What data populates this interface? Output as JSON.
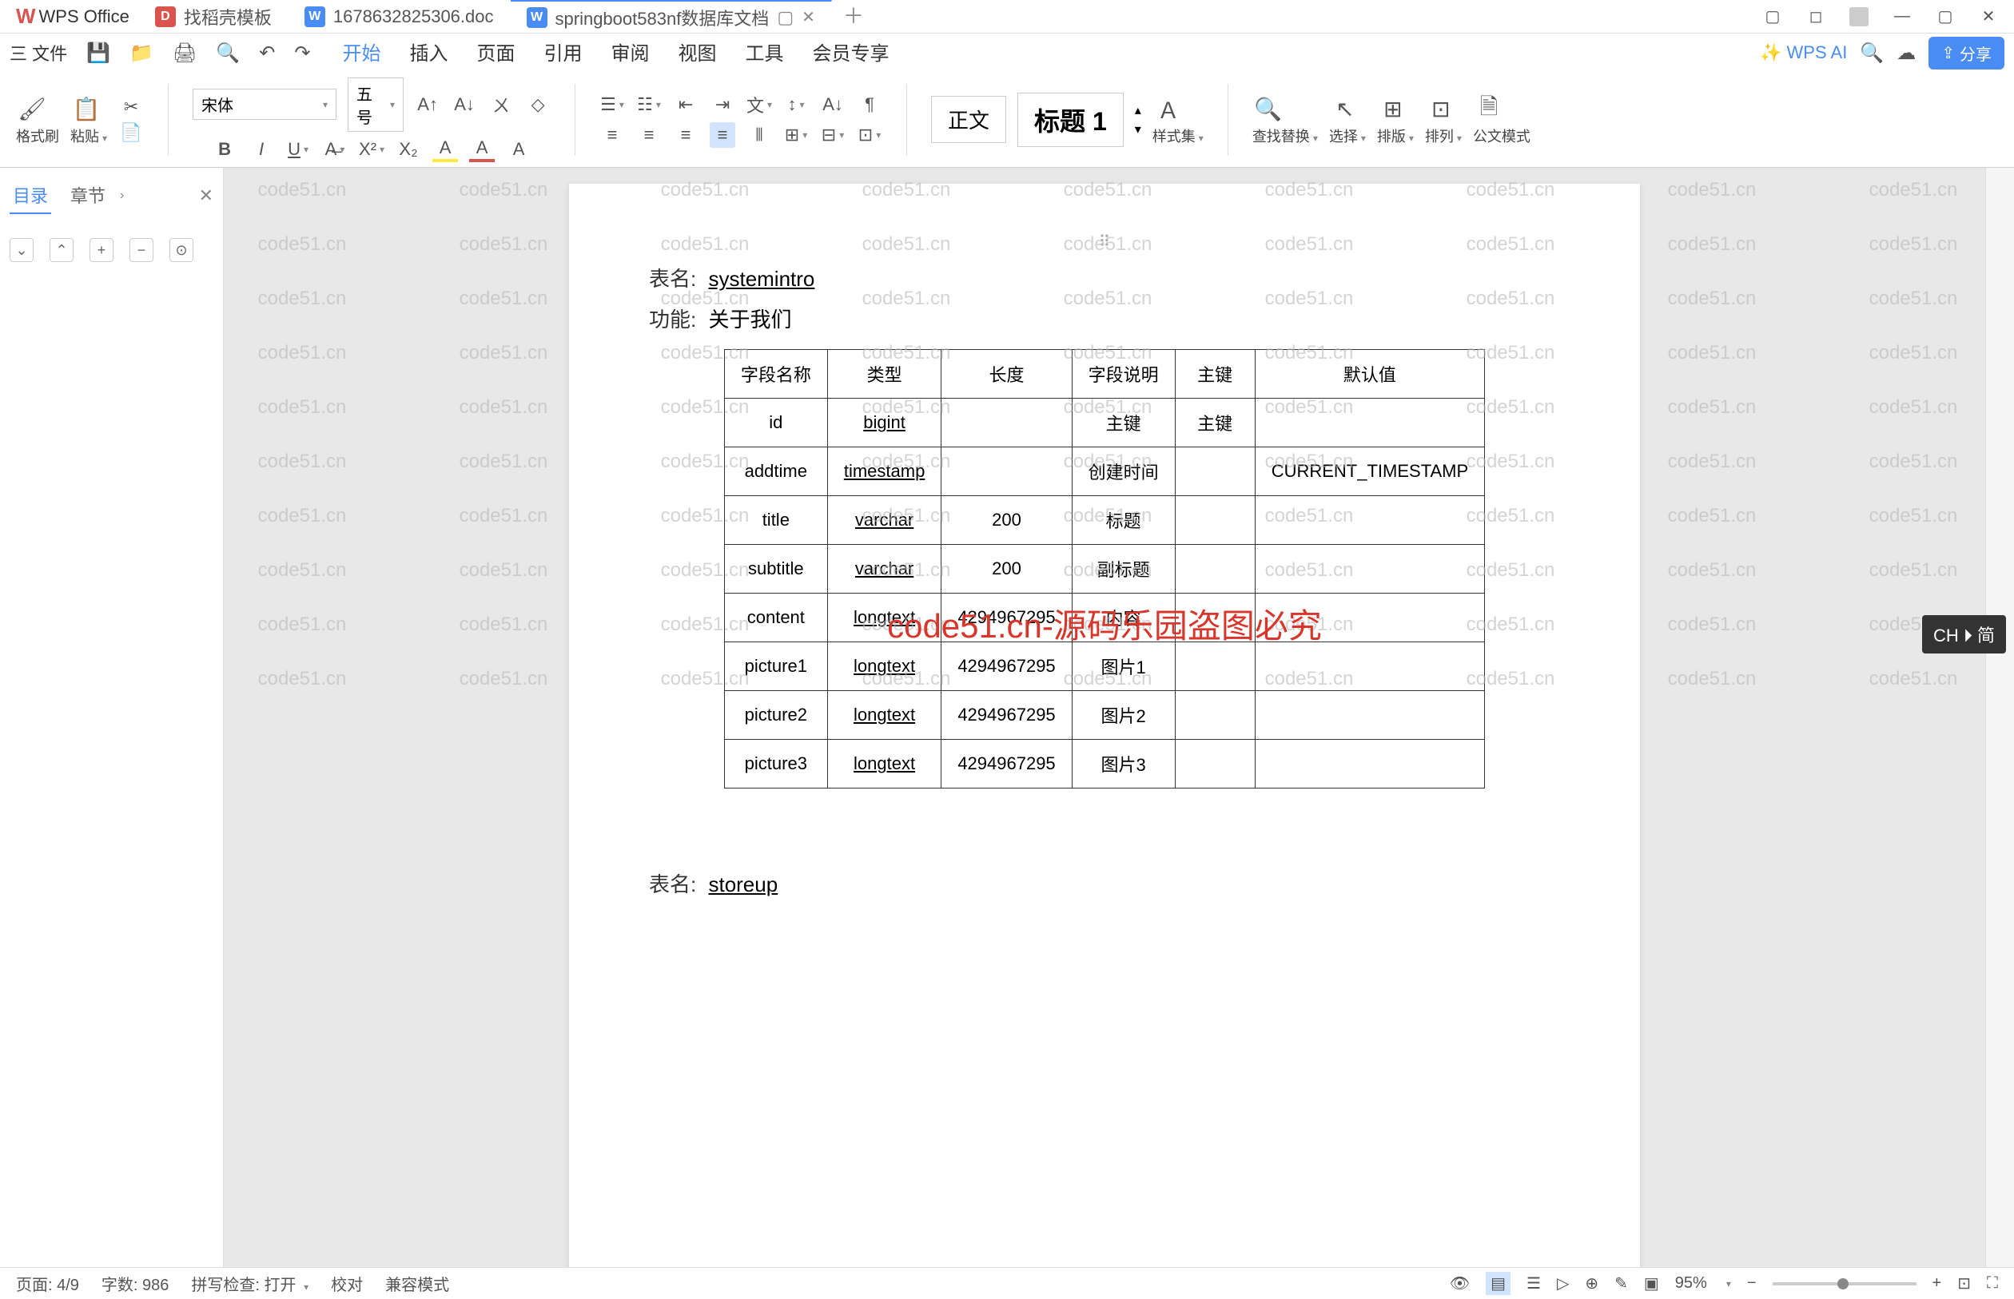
{
  "app": {
    "name": "WPS Office"
  },
  "tabs": [
    {
      "label": "找稻壳模板",
      "iconType": "red"
    },
    {
      "label": "1678632825306.doc",
      "iconType": "blue"
    },
    {
      "label": "springboot583nf数据库文档",
      "iconType": "blue",
      "active": true
    }
  ],
  "menubar": {
    "fileLabel": "三 文件",
    "items": [
      "开始",
      "插入",
      "页面",
      "引用",
      "审阅",
      "视图",
      "工具",
      "会员专享"
    ],
    "activeIndex": 0,
    "ai": "WPS AI",
    "share": "分享"
  },
  "ribbon": {
    "formatPainter": "格式刷",
    "paste": "粘贴",
    "fontName": "宋体",
    "fontSize": "五号",
    "styleNormal": "正文",
    "styleH1": "标题 1",
    "styleSet": "样式集",
    "findReplace": "查找替换",
    "select": "选择",
    "sort": "排版",
    "arrange": "排列",
    "formulaMode": "公文模式"
  },
  "sidebar": {
    "tabs": [
      "目录",
      "章节"
    ],
    "activeIndex": 0
  },
  "document": {
    "tableNameLabel": "表名:",
    "tableName1": "systemintro",
    "functionLabel": "功能:",
    "function1": "关于我们",
    "tableName2": "storeup",
    "headers": [
      "字段名称",
      "类型",
      "长度",
      "字段说明",
      "主键",
      "默认值"
    ],
    "rows": [
      {
        "name": "id",
        "type": "bigint",
        "len": "",
        "desc": "主键",
        "pk": "主键",
        "def": ""
      },
      {
        "name": "addtime",
        "type": "timestamp",
        "len": "",
        "desc": "创建时间",
        "pk": "",
        "def": "CURRENT_TIMESTAMP"
      },
      {
        "name": "title",
        "type": "varchar",
        "len": "200",
        "desc": "标题",
        "pk": "",
        "def": ""
      },
      {
        "name": "subtitle",
        "type": "varchar",
        "len": "200",
        "desc": "副标题",
        "pk": "",
        "def": ""
      },
      {
        "name": "content",
        "type": "longtext",
        "len": "4294967295",
        "desc": "内容",
        "pk": "",
        "def": ""
      },
      {
        "name": "picture1",
        "type": "longtext",
        "len": "4294967295",
        "desc": "图片1",
        "pk": "",
        "def": ""
      },
      {
        "name": "picture2",
        "type": "longtext",
        "len": "4294967295",
        "desc": "图片2",
        "pk": "",
        "def": ""
      },
      {
        "name": "picture3",
        "type": "longtext",
        "len": "4294967295",
        "desc": "图片3",
        "pk": "",
        "def": ""
      }
    ]
  },
  "overlay": "code51.cn-源码乐园盗图必究",
  "watermark": "code51.cn",
  "status": {
    "page": "页面: 4/9",
    "words": "字数: 986",
    "spell": "拼写检查: 打开",
    "proof": "校对",
    "compat": "兼容模式",
    "zoom": "95%"
  },
  "ime": "CH ⏵ 简"
}
